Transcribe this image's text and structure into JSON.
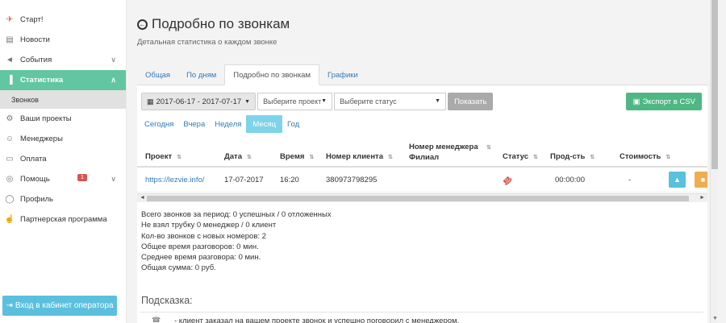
{
  "sidebar": {
    "items": [
      {
        "label": "Старт!",
        "icon": "rocket-icon"
      },
      {
        "label": "Новости",
        "icon": "newspaper-icon"
      },
      {
        "label": "События",
        "icon": "bullhorn-icon"
      },
      {
        "label": "Статистика",
        "icon": "bar-chart-icon"
      },
      {
        "label": "Звонков"
      },
      {
        "label": "Ваши проекты",
        "icon": "cogs-icon"
      },
      {
        "label": "Менеджеры",
        "icon": "users-icon"
      },
      {
        "label": "Оплата",
        "icon": "credit-card-icon"
      },
      {
        "label": "Помощь",
        "icon": "life-ring-icon",
        "badge": "1"
      },
      {
        "label": "Профиль",
        "icon": "user-icon"
      },
      {
        "label": "Партнерская программа",
        "icon": "thumbs-up-icon"
      }
    ],
    "operator_button": "Вход в кабинет оператора"
  },
  "page": {
    "title": "Подробно по звонкам",
    "subtitle": "Детальная статистика о каждом звонке"
  },
  "tabs": [
    {
      "label": "Общая"
    },
    {
      "label": "По дням"
    },
    {
      "label": "Подробно по звонкам",
      "active": true
    },
    {
      "label": "Графики"
    }
  ],
  "filters": {
    "date_range": "2017-06-17 - 2017-07-17",
    "project_select": "Выберите проект",
    "status_select": "Выберите статус",
    "show_button": "Показать",
    "export_button": "Экспорт в CSV"
  },
  "periods": [
    {
      "label": "Сегодня"
    },
    {
      "label": "Вчера"
    },
    {
      "label": "Неделя"
    },
    {
      "label": "Месяц",
      "active": true
    },
    {
      "label": "Год"
    }
  ],
  "table": {
    "headers": {
      "project": "Проект",
      "date": "Дата",
      "time": "Время",
      "client_number": "Номер клиента",
      "manager_number_line1": "Номер менеджера",
      "manager_number_line2": "Филиал",
      "status": "Статус",
      "duration": "Прод-сть",
      "cost": "Стоимость"
    },
    "rows": [
      {
        "project": "https://lezvie.info/",
        "date": "17-07-2017",
        "time": "16:20",
        "client_number": "380973798295",
        "duration": "00:00:00",
        "cost": "-"
      }
    ]
  },
  "stats": {
    "line1": "Всего звонков за период: 0 успешных / 0 отложенных",
    "line2": "Не взял трубку 0 менеджер / 0 клиент",
    "line3": "Кол-во звонков с новых номеров: 2",
    "line4": "Общее время разговоров: 0 мин.",
    "line5": "Среднее время разговора: 0 мин.",
    "line6": "Общая сумма: 0 руб."
  },
  "hint": {
    "title": "Подсказка:",
    "text": "- клиент заказал на вашем проекте звонок и успешно поговорил с менеджером."
  },
  "colors": {
    "accent_green": "#62c6a2",
    "link_blue": "#337ab7",
    "info_blue": "#5bc0de",
    "export_green": "#4fb783",
    "warning_orange": "#f0ad4e",
    "danger_red": "#d9534f"
  }
}
